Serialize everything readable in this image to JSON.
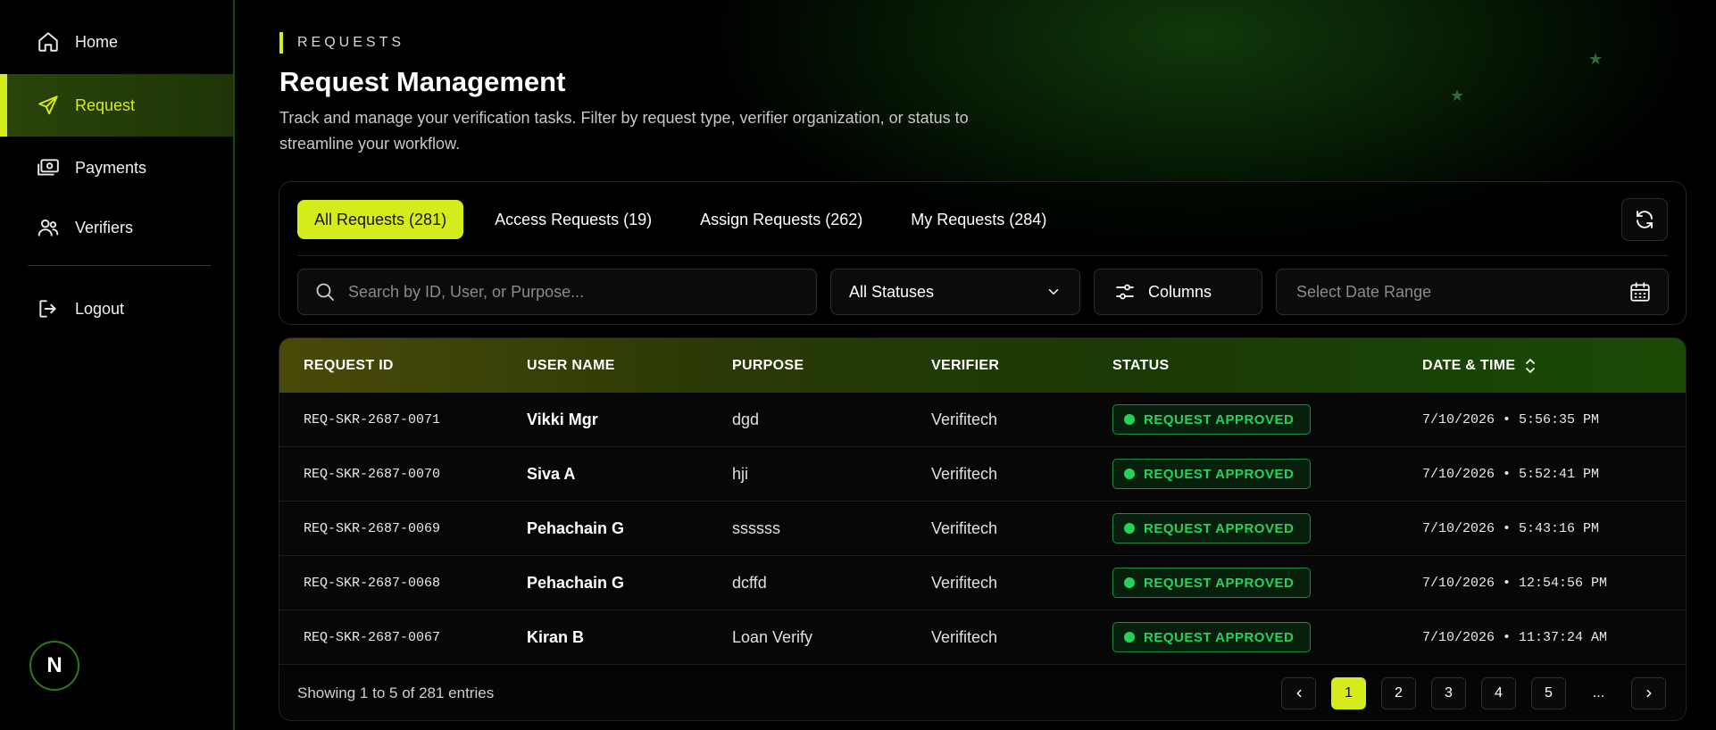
{
  "sidebar": {
    "items": [
      {
        "label": "Home",
        "icon": "home-icon"
      },
      {
        "label": "Request",
        "icon": "send-icon",
        "active": true
      },
      {
        "label": "Payments",
        "icon": "payments-icon"
      },
      {
        "label": "Verifiers",
        "icon": "users-icon"
      }
    ],
    "logout_label": "Logout",
    "avatar_initial": "N"
  },
  "header": {
    "eyebrow": "REQUESTS",
    "title": "Request Management",
    "subtitle": "Track and manage your verification tasks. Filter by request type, verifier organization, or status to streamline your workflow."
  },
  "tabs": [
    {
      "label": "All Requests (281)",
      "active": true
    },
    {
      "label": "Access Requests (19)"
    },
    {
      "label": "Assign Requests (262)"
    },
    {
      "label": "My Requests (284)"
    }
  ],
  "filters": {
    "search_placeholder": "Search by ID, User, or Purpose...",
    "status_value": "All Statuses",
    "columns_label": "Columns",
    "date_placeholder": "Select Date Range"
  },
  "table": {
    "columns": [
      "REQUEST ID",
      "USER NAME",
      "PURPOSE",
      "VERIFIER",
      "STATUS",
      "DATE & TIME"
    ],
    "rows": [
      {
        "id": "REQ-SKR-2687-0071",
        "user": "Vikki Mgr",
        "purpose": "dgd",
        "verifier": "Verifitech",
        "status": "REQUEST APPROVED",
        "datetime": "7/10/2026 • 5:56:35 PM"
      },
      {
        "id": "REQ-SKR-2687-0070",
        "user": "Siva A",
        "purpose": "hji",
        "verifier": "Verifitech",
        "status": "REQUEST APPROVED",
        "datetime": "7/10/2026 • 5:52:41 PM"
      },
      {
        "id": "REQ-SKR-2687-0069",
        "user": "Pehachain G",
        "purpose": "ssssss",
        "verifier": "Verifitech",
        "status": "REQUEST APPROVED",
        "datetime": "7/10/2026 • 5:43:16 PM"
      },
      {
        "id": "REQ-SKR-2687-0068",
        "user": "Pehachain G",
        "purpose": "dcffd",
        "verifier": "Verifitech",
        "status": "REQUEST APPROVED",
        "datetime": "7/10/2026 • 12:54:56 PM"
      },
      {
        "id": "REQ-SKR-2687-0067",
        "user": "Kiran B",
        "purpose": "Loan Verify",
        "verifier": "Verifitech",
        "status": "REQUEST APPROVED",
        "datetime": "7/10/2026 • 11:37:24 AM"
      }
    ],
    "footer_text": "Showing 1 to 5 of 281 entries",
    "pages": [
      "1",
      "2",
      "3",
      "4",
      "5",
      "..."
    ],
    "current_page": "1"
  },
  "colors": {
    "accent": "#d4ec1c",
    "status_green": "#25d35a",
    "background": "#000000"
  }
}
